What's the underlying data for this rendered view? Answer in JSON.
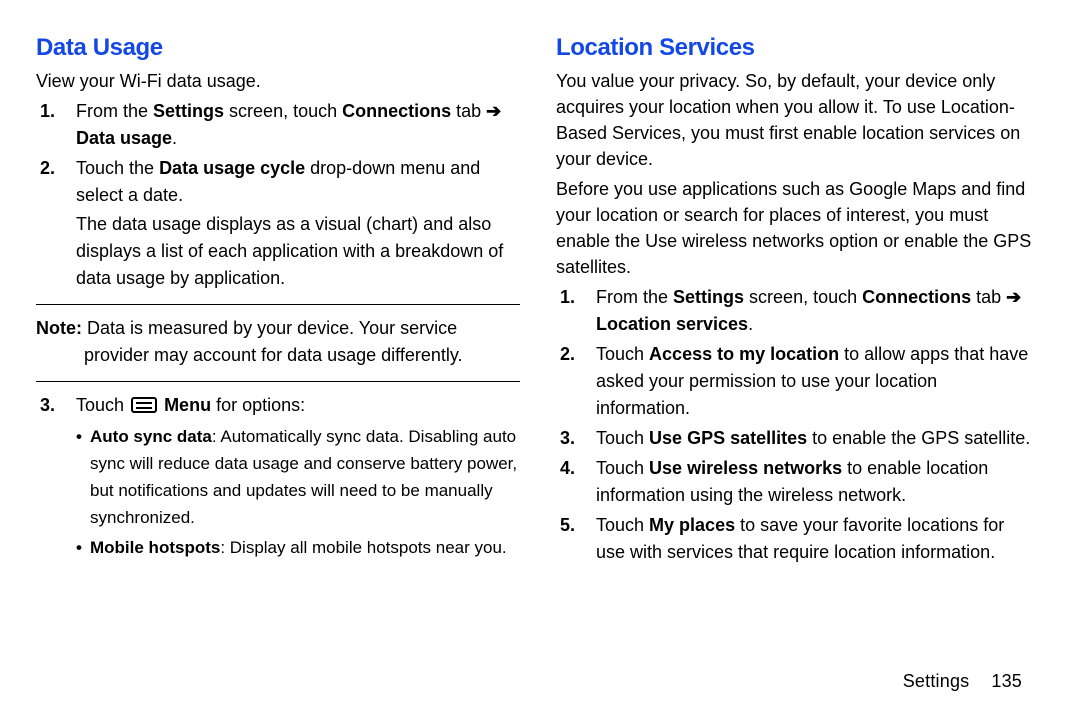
{
  "left": {
    "heading": "Data Usage",
    "intro": "View your Wi-Fi data usage.",
    "step1_a": "From the ",
    "step1_b": "Settings",
    "step1_c": " screen, touch ",
    "step1_d": "Connections",
    "step1_e": " tab ",
    "step1_f": "Data usage",
    "step1_g": ".",
    "step2_a": "Touch the ",
    "step2_b": "Data usage cycle",
    "step2_c": " drop-down menu and select a date.",
    "step2_sub": "The data usage displays as a visual (chart) and also displays a list of each application with a breakdown of data usage by application.",
    "note_label": "Note:",
    "note_text": " Data is measured by your device. Your service provider may account for data usage differently.",
    "step3_a": "Touch ",
    "step3_b": "Menu",
    "step3_c": " for options:",
    "bullet1_a": "Auto sync data",
    "bullet1_b": ": Automatically sync data. Disabling auto sync will reduce data usage and conserve battery power, but notifications and updates will need to be manually synchronized.",
    "bullet2_a": "Mobile hotspots",
    "bullet2_b": ": Display all mobile hotspots near you."
  },
  "right": {
    "heading": "Location Services",
    "p1": "You value your privacy. So, by default, your device only acquires your location when you allow it. To use Location-Based Services, you must first enable location services on your device.",
    "p2": "Before you use applications such as Google Maps and find your location or search for places of interest, you must enable the Use wireless networks option or enable the GPS satellites.",
    "step1_a": "From the ",
    "step1_b": "Settings",
    "step1_c": " screen, touch ",
    "step1_d": "Connections",
    "step1_e": " tab ",
    "step1_f": "Location services",
    "step1_g": ".",
    "step2_a": "Touch ",
    "step2_b": "Access to my location",
    "step2_c": " to allow apps that have asked your permission to use your location information.",
    "step3_a": "Touch ",
    "step3_b": "Use GPS satellites",
    "step3_c": " to enable the GPS satellite.",
    "step4_a": "Touch ",
    "step4_b": "Use wireless networks",
    "step4_c": " to enable location information using the wireless network.",
    "step5_a": "Touch ",
    "step5_b": "My places",
    "step5_c": " to save your favorite locations for use with services that require location information."
  },
  "footer": {
    "section": "Settings",
    "page": "135"
  },
  "arrow": "➔"
}
